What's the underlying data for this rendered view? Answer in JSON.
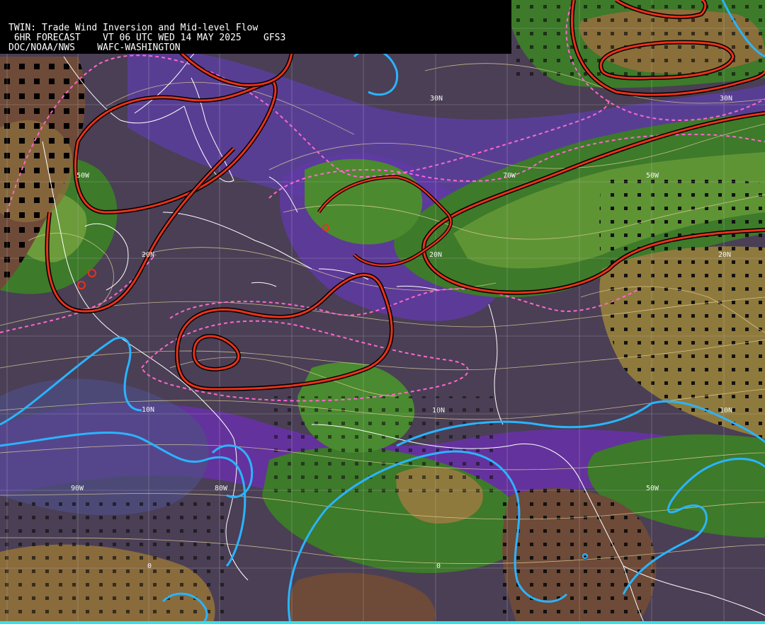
{
  "header": {
    "line1": "TWIN: Trade Wind Inversion and Mid-level Flow",
    "line2": " 6HR FORECAST    VT 06 UTC WED 14 MAY 2025    GFS3",
    "line3": "DOC/NOAA/NWS    WAFC-WASHINGTON"
  },
  "grid_labels": {
    "lat": [
      "30N",
      "30N",
      "20N",
      "20N",
      "20N",
      "10N",
      "10N",
      "10N",
      "0",
      "0"
    ],
    "lon": [
      "50W",
      "70W",
      "50W",
      "90W",
      "80W",
      "50W"
    ]
  },
  "colors": {
    "background_low": "#4a3f55",
    "purple_band": "#6a2fae",
    "slate_band": "#4f4f86",
    "green_dark": "#3d7a2a",
    "green_light": "#6b9b3a",
    "tan": "#8f7a3d",
    "brown": "#6e4a38",
    "inversion_contour": "#e8321a",
    "dashed_contour": "#ff66cc",
    "cyan_contour": "#2ab4ff",
    "streamline": "#e6d39a",
    "coastline": "#ffffff",
    "grid": "#b9b9b9",
    "bottom_bar": "#36e0e8"
  }
}
